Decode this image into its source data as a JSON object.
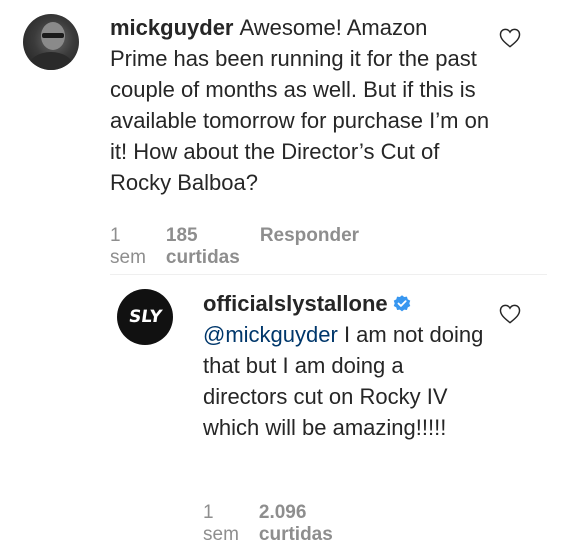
{
  "comments": [
    {
      "username": "mickguyder",
      "text": "Awesome! Amazon Prime has been running it for the past couple of months as well. But if this is available tomorrow for purchase I’m on it! How about the Director’s Cut of Rocky Balboa?",
      "time": "1 sem",
      "likes": "185 curtidas",
      "reply": "Responder"
    },
    {
      "username": "officialslystallone",
      "verified": true,
      "avatar_text": "SLY",
      "mention": "@mickguyder",
      "text": " I am not doing that but I am doing a directors cut on Rocky IV which will be amazing!!!!!",
      "time": "1 sem",
      "likes": "2.096 curtidas"
    }
  ],
  "colors": {
    "text": "#262626",
    "meta": "#8e8e8e",
    "mention": "#00376b",
    "verified": "#3897f0"
  },
  "icons": {
    "like": "heart-outline-icon",
    "verified": "verified-badge-icon"
  }
}
